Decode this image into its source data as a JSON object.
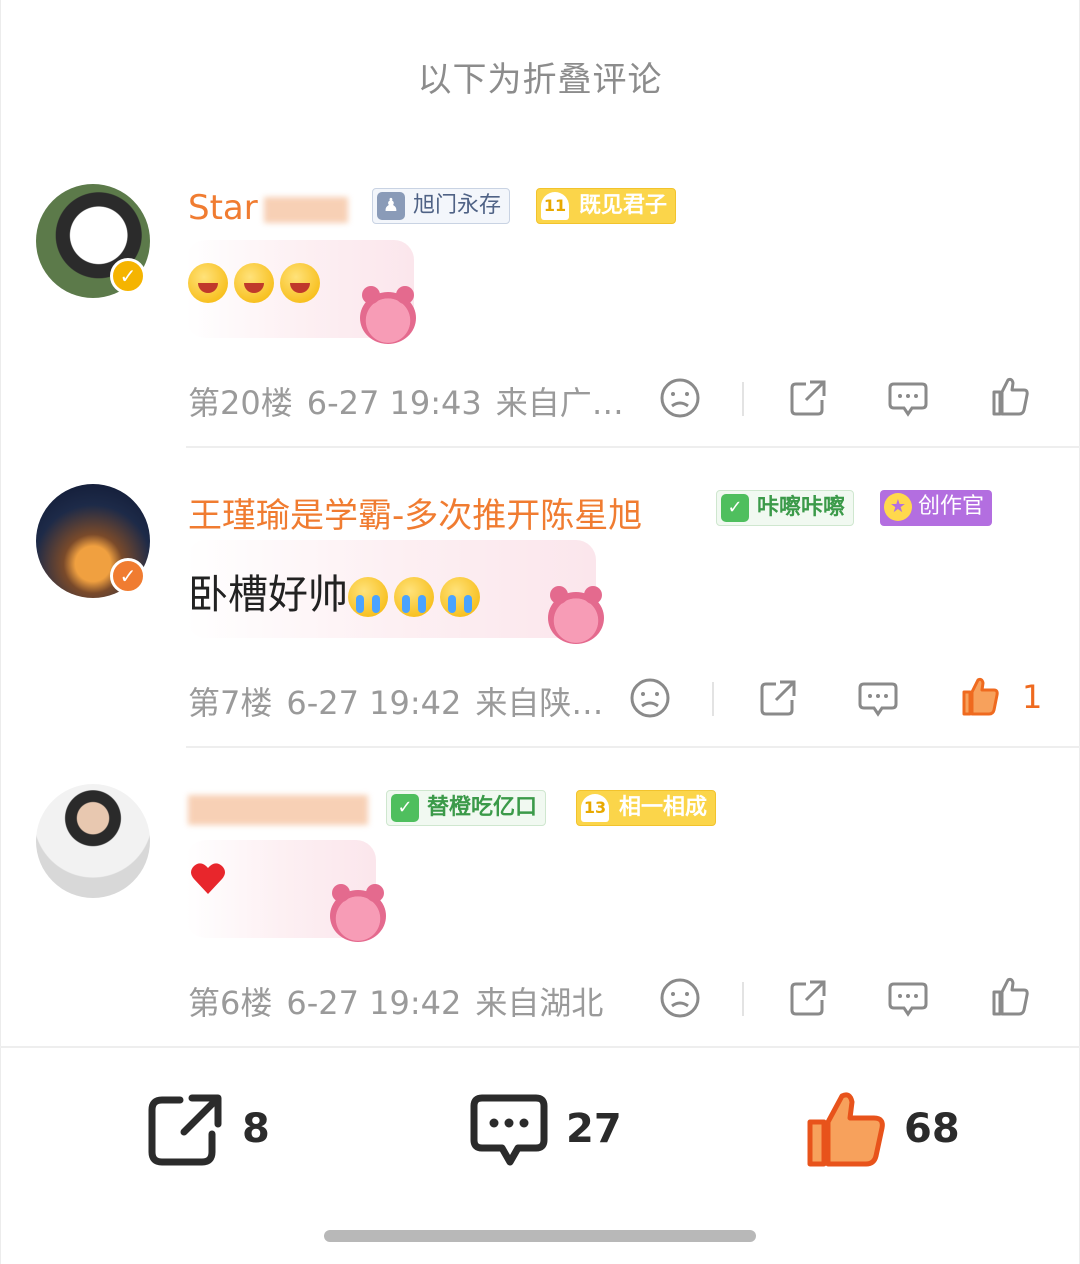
{
  "header": {
    "title": "以下为折叠评论"
  },
  "comments": [
    {
      "username": "Star",
      "fan_tag": "旭门永存",
      "level_tag": {
        "level": "11",
        "label": "既见君子"
      },
      "text": "",
      "meta": {
        "floor": "第20楼",
        "time": "6-27 19:43",
        "location": "来自广…"
      },
      "likes": ""
    },
    {
      "username": "王瑾瑜是学霸-多次推开陈星旭",
      "fan_tag": "咔嚓咔嚓",
      "creator_tag": "创作官",
      "text": "卧槽好帅",
      "meta": {
        "floor": "第7楼",
        "time": "6-27 19:42",
        "location": "来自陕…"
      },
      "likes": "1"
    },
    {
      "username": "",
      "fan_tag": "替橙吃亿口",
      "level_tag": {
        "level": "13",
        "label": "相一相成"
      },
      "text": "",
      "meta": {
        "floor": "第6楼",
        "time": "6-27 19:42",
        "location": "来自湖北"
      },
      "likes": ""
    }
  ],
  "bottom_bar": {
    "repost_count": "8",
    "comment_count": "27",
    "like_count": "68"
  },
  "colors": {
    "username": "#f07c31",
    "meta": "#9a9a9a",
    "like_active": "#ef6a1f",
    "verify_gold": "#f5b400",
    "verify_orange": "#f07c31"
  }
}
